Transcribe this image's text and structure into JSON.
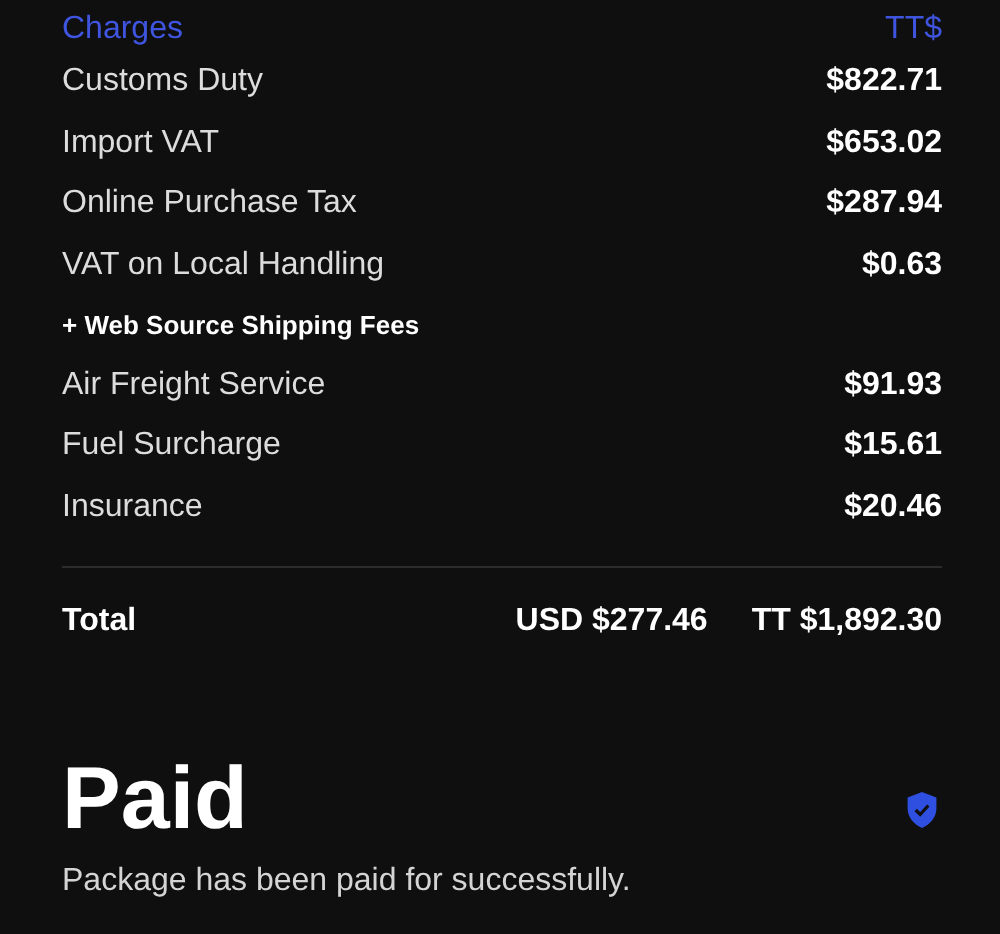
{
  "header": {
    "label": "Charges",
    "currency": "TT$"
  },
  "rows": [
    {
      "kind": "charge",
      "label": "Customs Duty",
      "amount": "$822.71"
    },
    {
      "kind": "charge",
      "label": "Import VAT",
      "amount": "$653.02"
    },
    {
      "kind": "charge",
      "label": "Online Purchase Tax",
      "amount": "$287.94"
    },
    {
      "kind": "charge",
      "label": "VAT on Local Handling",
      "amount": "$0.63"
    },
    {
      "kind": "subheading",
      "label": "+ Web Source Shipping Fees"
    },
    {
      "kind": "charge",
      "label": "Air Freight Service",
      "amount": "$91.93"
    },
    {
      "kind": "charge",
      "label": "Fuel Surcharge",
      "amount": "$15.61"
    },
    {
      "kind": "charge",
      "label": "Insurance",
      "amount": "$20.46"
    }
  ],
  "total": {
    "label": "Total",
    "usd": "USD $277.46",
    "tt": "TT $1,892.30"
  },
  "status": {
    "title": "Paid",
    "message": "Package has been paid for successfully."
  }
}
